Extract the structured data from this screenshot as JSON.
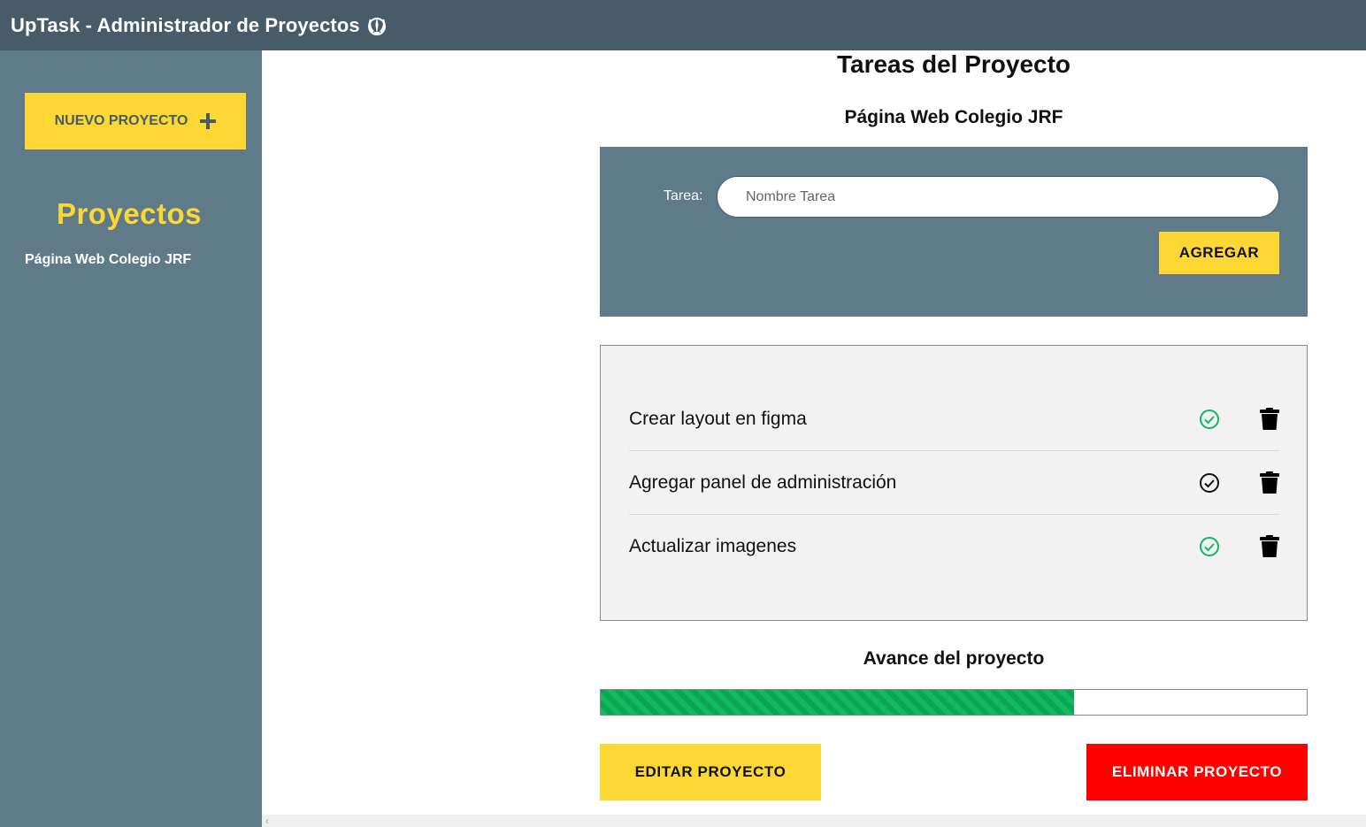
{
  "app": {
    "title": "UpTask - Administrador de Proyectos",
    "logo_icon": "jedi-order-icon"
  },
  "sidebar": {
    "new_project_label": "NUEVO PROYECTO",
    "new_project_icon": "plus-icon",
    "heading": "Proyectos",
    "projects": [
      {
        "label": "Página Web Colegio JRF"
      }
    ]
  },
  "main": {
    "title": "Tareas del Proyecto",
    "project_name": "Página Web Colegio JRF",
    "form": {
      "label": "Tarea:",
      "input_value": "",
      "input_placeholder": "Nombre Tarea",
      "add_button_label": "AGREGAR"
    },
    "tasks": [
      {
        "text": "Crear layout en figma",
        "completed": true
      },
      {
        "text": "Agregar panel de administración",
        "completed": false
      },
      {
        "text": "Actualizar imagenes",
        "completed": true
      }
    ],
    "progress": {
      "title": "Avance del proyecto",
      "percent": 67
    },
    "edit_button_label": "EDITAR PROYECTO",
    "delete_button_label": "ELIMINAR PROYECTO"
  },
  "colors": {
    "header": "#475c68",
    "sidebar": "#5f7b8a",
    "accent": "#fdd835",
    "complete": "#12b862",
    "danger": "#ff0000"
  }
}
